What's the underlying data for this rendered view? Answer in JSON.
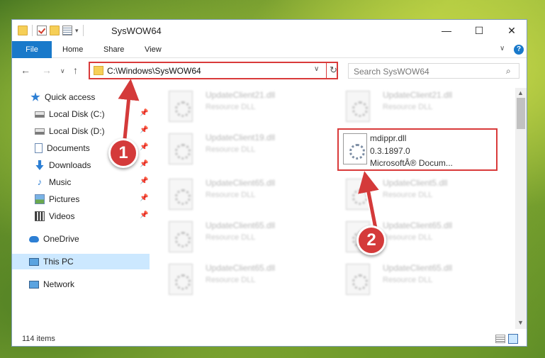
{
  "window": {
    "title": "SysWOW64",
    "minimize": "—",
    "maximize": "☐",
    "close": "✕"
  },
  "ribbon": {
    "tabs": [
      "File",
      "Home",
      "Share",
      "View"
    ],
    "expand": "∨",
    "help": "?"
  },
  "nav": {
    "back": "←",
    "forward": "→",
    "recent": "∨",
    "up": "↑"
  },
  "address": {
    "path": "C:\\Windows\\SysWOW64",
    "dropdown": "∨",
    "refresh": "↻"
  },
  "search": {
    "placeholder": "Search SysWOW64",
    "icon": "⌕"
  },
  "sidebar": {
    "pin_glyph": "📌",
    "items": [
      {
        "label": "Quick access",
        "icon": "star-icon"
      },
      {
        "label": "Local Disk (C:)",
        "icon": "disk-icon"
      },
      {
        "label": "Local Disk (D:)",
        "icon": "disk-icon"
      },
      {
        "label": "Documents",
        "icon": "documents-icon"
      },
      {
        "label": "Downloads",
        "icon": "downloads-icon"
      },
      {
        "label": "Music",
        "icon": "music-icon"
      },
      {
        "label": "Pictures",
        "icon": "pictures-icon"
      },
      {
        "label": "Videos",
        "icon": "videos-icon"
      },
      {
        "label": "OneDrive",
        "icon": "onedrive-icon"
      },
      {
        "label": "This PC",
        "icon": "this-pc-icon"
      },
      {
        "label": "Network",
        "icon": "network-icon"
      }
    ]
  },
  "files": [
    {
      "name": "UpdateClient21.dll",
      "desc": "Resource DLL"
    },
    {
      "name": "UpdateClient21.dll",
      "desc": "Resource DLL"
    },
    {
      "name": "UpdateClient19.dll",
      "desc": "Resource DLL"
    },
    {
      "name": "mdippr.dll",
      "version": "0.3.1897.0",
      "desc": "MicrosoftÂ® Docum..."
    },
    {
      "name": "UpdateClient65.dll",
      "desc": "Resource DLL"
    },
    {
      "name": "UpdateClient5.dll",
      "desc": "Resource DLL"
    },
    {
      "name": "UpdateClient65.dll",
      "desc": "Resource DLL"
    },
    {
      "name": "UpdateClient65.dll",
      "desc": "Resource DLL"
    },
    {
      "name": "UpdateClient65.dll",
      "desc": "Resource DLL"
    },
    {
      "name": "UpdateClient65.dll",
      "desc": "Resource DLL"
    }
  ],
  "scrollbar": {
    "up": "▲",
    "down": "▼"
  },
  "status": {
    "item_count": "114 items"
  },
  "annotations": [
    {
      "number": "1"
    },
    {
      "number": "2"
    }
  ],
  "colors": {
    "highlight": "#d93a3a",
    "accent": "#1979ca",
    "selected": "#cce8ff"
  }
}
